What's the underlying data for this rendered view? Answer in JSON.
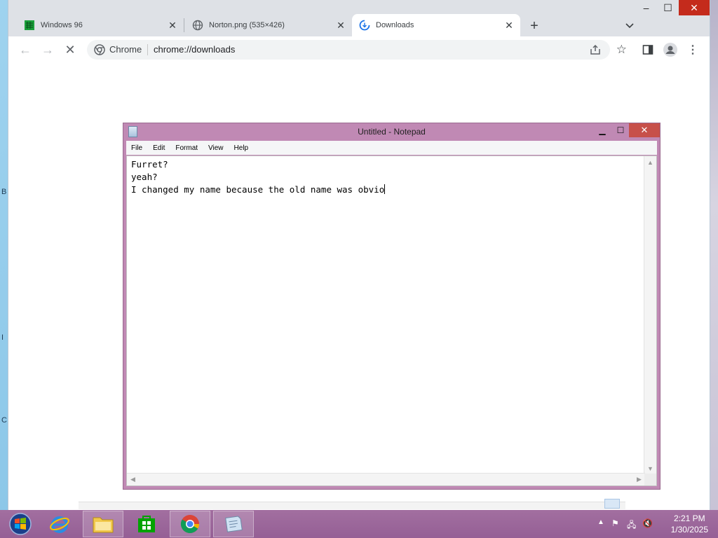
{
  "browser": {
    "tabs": [
      {
        "title": "Windows 96",
        "icon": "windows96-favicon",
        "active": false
      },
      {
        "title": "Norton.png (535×426)",
        "icon": "globe-icon",
        "active": false
      },
      {
        "title": "Downloads",
        "icon": "downloads-loading-icon",
        "active": true
      }
    ],
    "new_tab_label": "+",
    "omnibox": {
      "site_label": "Chrome",
      "url": "chrome://downloads"
    }
  },
  "notepad": {
    "title": "Untitled - Notepad",
    "menu": [
      "File",
      "Edit",
      "Format",
      "View",
      "Help"
    ],
    "lines": [
      "Furret?",
      "yeah?",
      "I changed my name because the old name was obvio"
    ]
  },
  "taskbar": {
    "apps": [
      "start-orb",
      "internet-explorer",
      "file-explorer",
      "store",
      "chrome",
      "notepad"
    ],
    "clock_time": "2:21 PM",
    "clock_date": "1/30/2025"
  },
  "desktop": {
    "edge_letters": [
      "B",
      "I",
      "C"
    ]
  },
  "colors": {
    "taskbar": "#955f95",
    "notepad_frame": "#c089b4",
    "close_red": "#c42b1c"
  }
}
